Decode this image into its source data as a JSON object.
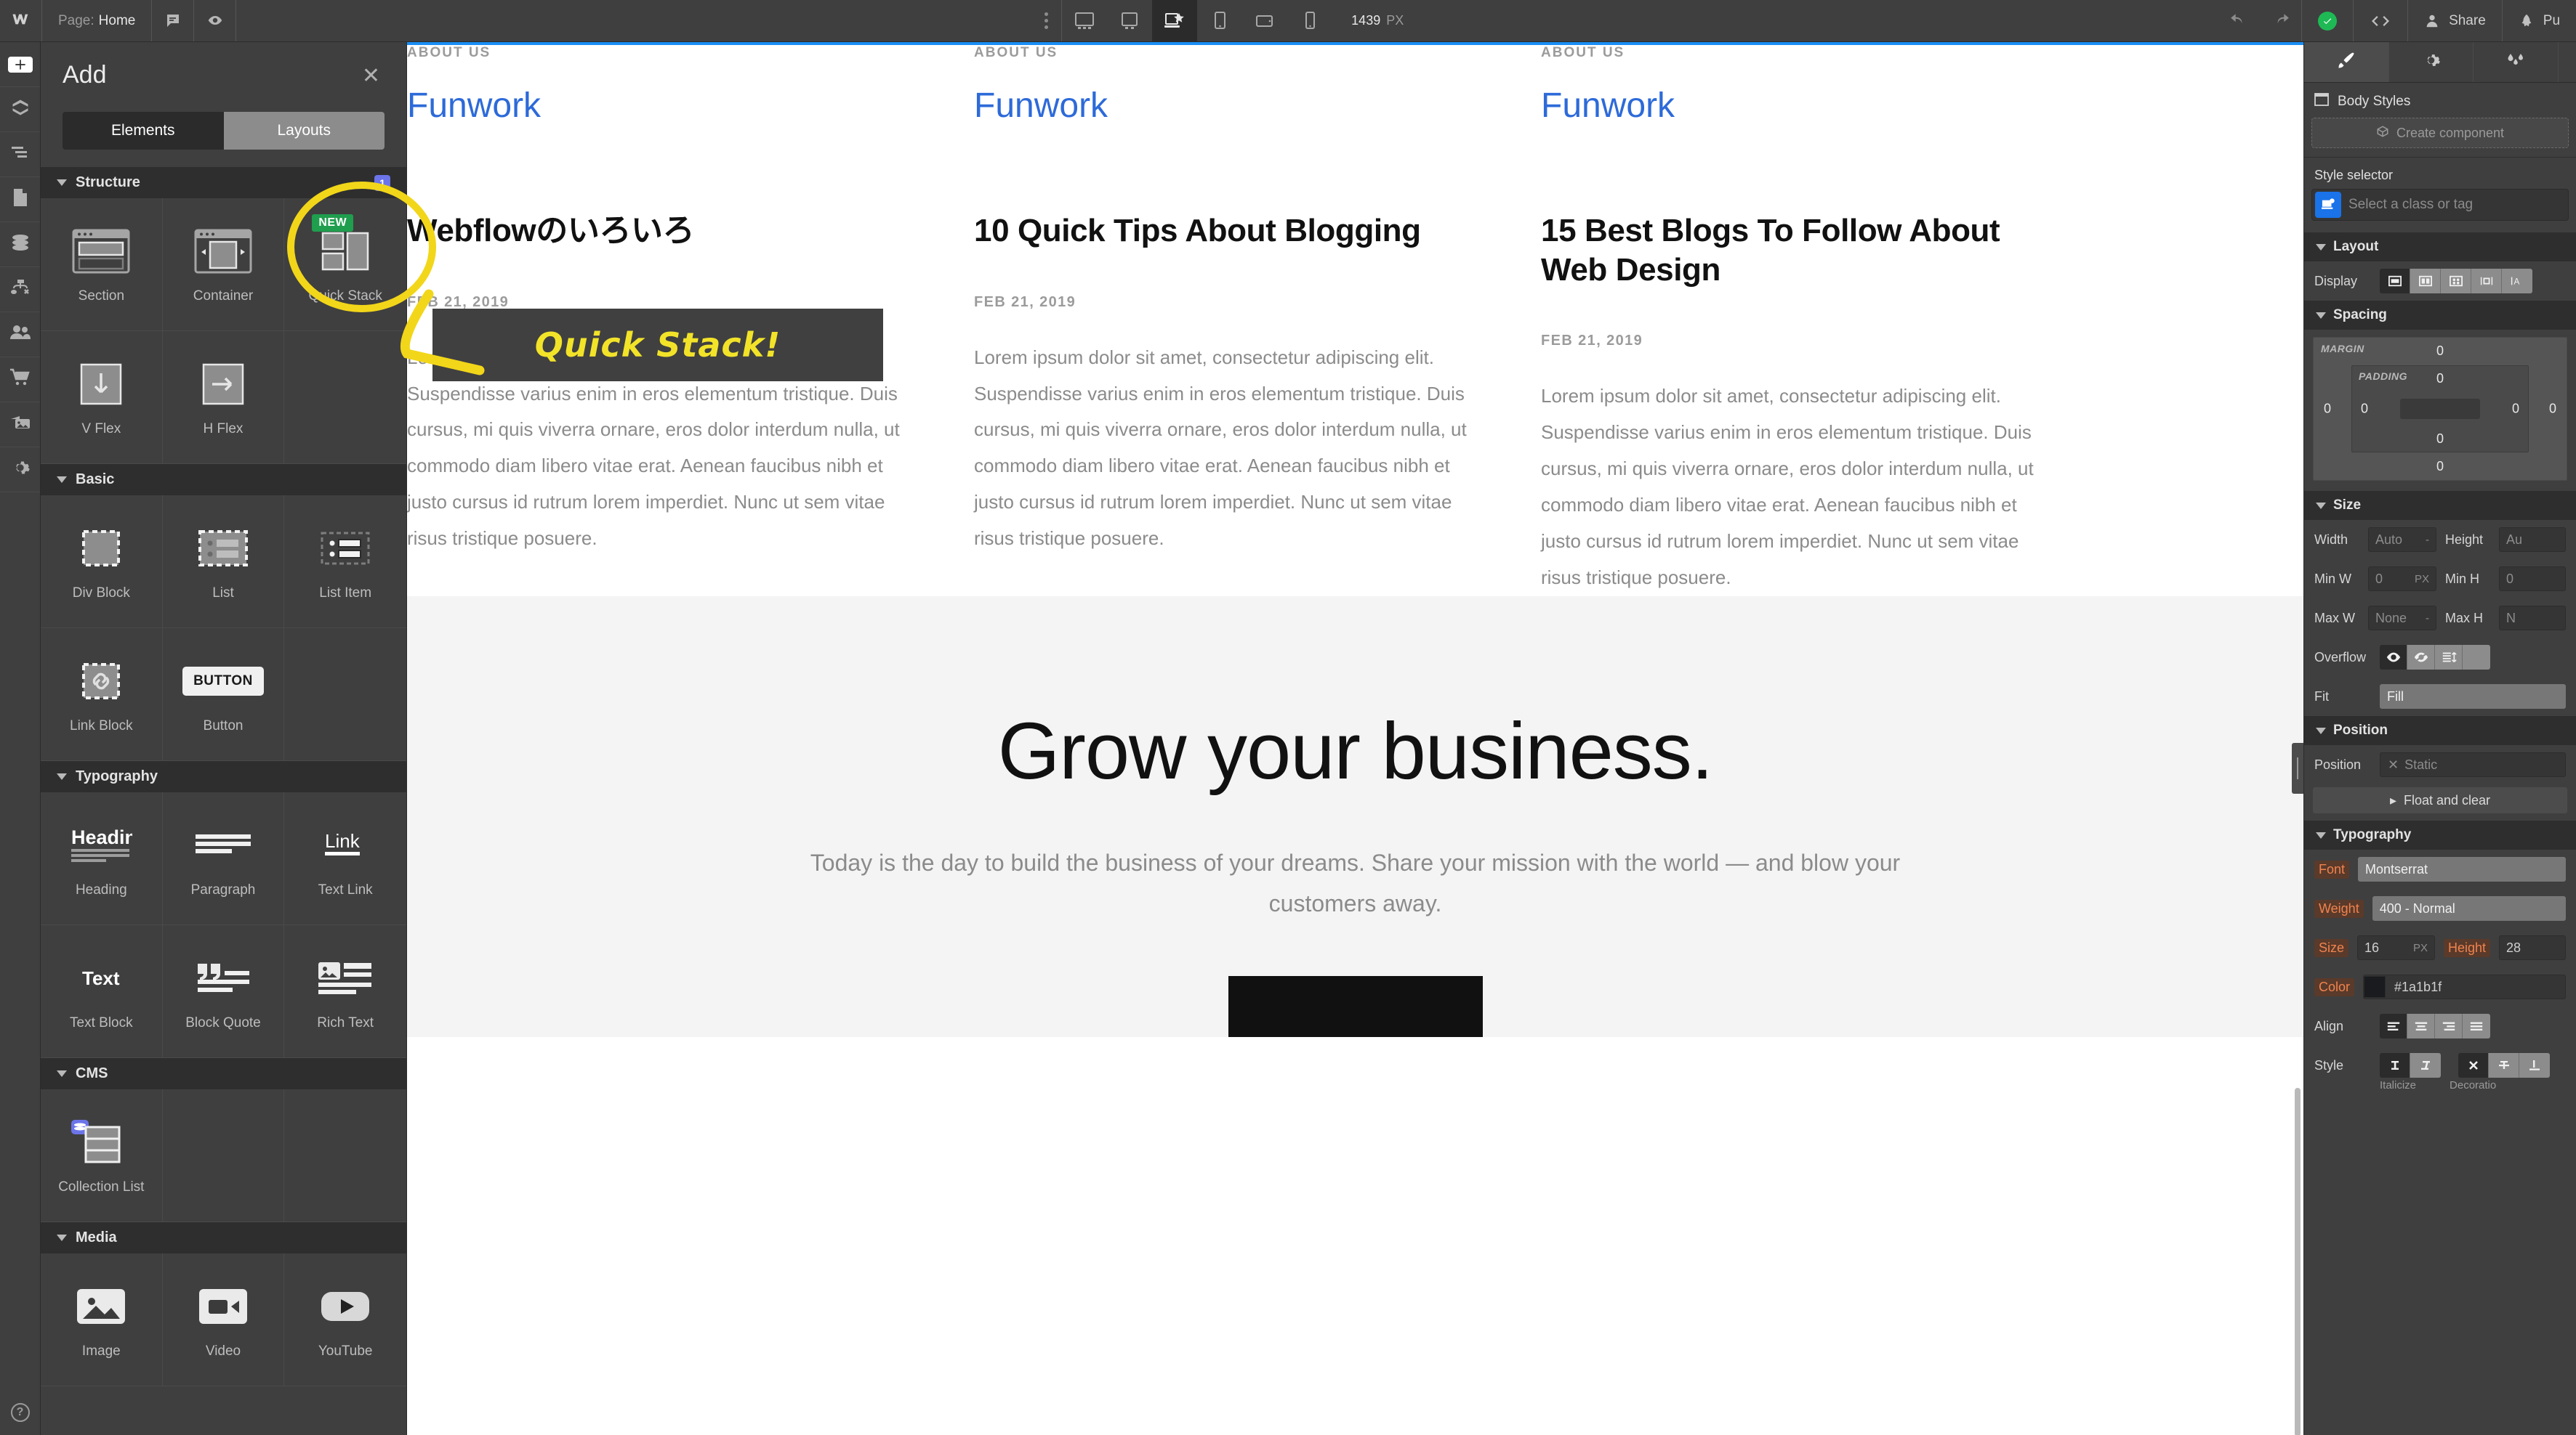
{
  "topbar": {
    "logo_icon": "webflow-logo-icon",
    "page_label": "Page:",
    "page_name": "Home",
    "comment_icon": "comment-icon",
    "preview_icon": "eye-icon",
    "breakpoints": [
      {
        "name": "desktop-xl",
        "icon": "monitor-large-icon",
        "active": false
      },
      {
        "name": "desktop-large",
        "icon": "monitor-icon",
        "active": false
      },
      {
        "name": "desktop-base",
        "icon": "laptop-star-icon",
        "active": true
      },
      {
        "name": "tablet",
        "icon": "tablet-icon",
        "active": false
      },
      {
        "name": "mobile-landscape",
        "icon": "mobile-landscape-icon",
        "active": false
      },
      {
        "name": "mobile-portrait",
        "icon": "mobile-portrait-icon",
        "active": false
      }
    ],
    "viewport_size": "1439",
    "viewport_unit": "PX",
    "undo_icon": "undo-icon",
    "redo_icon": "redo-icon",
    "saved_icon": "check-circle-icon",
    "code_icon": "code-brackets-icon",
    "share_label": "Share",
    "share_icon": "person-icon",
    "publish_label": "Pu",
    "publish_icon": "rocket-icon"
  },
  "rail": {
    "items": [
      {
        "name": "add-elements",
        "icon": "plus-icon",
        "active": true
      },
      {
        "name": "components",
        "icon": "cube-icon",
        "active": false
      },
      {
        "name": "navigator",
        "icon": "layers-list-icon",
        "active": false
      },
      {
        "name": "pages",
        "icon": "page-icon",
        "active": false
      },
      {
        "name": "cms",
        "icon": "database-icon",
        "active": false
      },
      {
        "name": "logic",
        "icon": "flow-node-icon",
        "active": false
      },
      {
        "name": "users",
        "icon": "users-icon",
        "active": false
      },
      {
        "name": "ecommerce",
        "icon": "cart-icon",
        "active": false
      },
      {
        "name": "assets",
        "icon": "photos-icon",
        "active": false
      },
      {
        "name": "settings",
        "icon": "gear-icon",
        "active": false
      }
    ],
    "help_label": "?"
  },
  "add_panel": {
    "title": "Add",
    "close_icon": "close-icon",
    "tabs": [
      {
        "label": "Elements",
        "active": true
      },
      {
        "label": "Layouts",
        "active": false
      }
    ],
    "sections": [
      {
        "title": "Structure",
        "badge": "1",
        "items": [
          {
            "label": "Section",
            "icon": "section-icon",
            "badge": ""
          },
          {
            "label": "Container",
            "icon": "container-icon",
            "badge": ""
          },
          {
            "label": "Quick Stack",
            "icon": "quick-stack-icon",
            "badge": "NEW"
          },
          {
            "label": "V Flex",
            "icon": "vertical-flex-icon",
            "badge": ""
          },
          {
            "label": "H Flex",
            "icon": "horizontal-flex-icon",
            "badge": ""
          },
          {
            "label": "",
            "icon": "",
            "badge": ""
          }
        ]
      },
      {
        "title": "Basic",
        "badge": "",
        "items": [
          {
            "label": "Div Block",
            "icon": "div-block-icon",
            "badge": ""
          },
          {
            "label": "List",
            "icon": "list-icon",
            "badge": ""
          },
          {
            "label": "List Item",
            "icon": "list-item-icon",
            "badge": ""
          },
          {
            "label": "Link Block",
            "icon": "link-block-icon",
            "badge": ""
          },
          {
            "label": "Button",
            "icon": "button-icon",
            "badge": ""
          },
          {
            "label": "",
            "icon": "",
            "badge": ""
          }
        ]
      },
      {
        "title": "Typography",
        "badge": "",
        "items": [
          {
            "label": "Heading",
            "icon": "heading-icon",
            "badge": ""
          },
          {
            "label": "Paragraph",
            "icon": "paragraph-icon",
            "badge": ""
          },
          {
            "label": "Text Link",
            "icon": "text-link-icon",
            "badge": ""
          },
          {
            "label": "Text Block",
            "icon": "text-block-icon",
            "badge": ""
          },
          {
            "label": "Block Quote",
            "icon": "block-quote-icon",
            "badge": ""
          },
          {
            "label": "Rich Text",
            "icon": "rich-text-icon",
            "badge": ""
          }
        ]
      },
      {
        "title": "CMS",
        "badge": "",
        "items": [
          {
            "label": "Collection List",
            "icon": "collection-list-icon",
            "badge": ""
          },
          {
            "label": "",
            "icon": "",
            "badge": ""
          },
          {
            "label": "",
            "icon": "",
            "badge": ""
          }
        ]
      },
      {
        "title": "Media",
        "badge": "",
        "items": [
          {
            "label": "Image",
            "icon": "image-icon",
            "badge": ""
          },
          {
            "label": "Video",
            "icon": "video-icon",
            "badge": ""
          },
          {
            "label": "YouTube",
            "icon": "youtube-icon",
            "badge": ""
          }
        ]
      }
    ]
  },
  "annotation": {
    "text": "Quick Stack!",
    "highlight_color": "#f2d619",
    "text_color": "#f2e329",
    "box_color": "#404040"
  },
  "canvas": {
    "selection_color": "#1a8ef5",
    "cards": [
      {
        "eyebrow": "ABOUT US",
        "brand": "Funwork",
        "title": "Webflowのいろいろ",
        "date": "FEB 21, 2019",
        "body": "Lorem ipsum dolor sit amet, consectetur adipiscing elit. Suspendisse varius enim in eros elementum tristique. Duis cursus, mi quis viverra ornare, eros dolor interdum nulla, ut commodo diam libero vitae erat. Aenean faucibus nibh et justo cursus id rutrum lorem imperdiet. Nunc ut sem vitae risus tristique posuere."
      },
      {
        "eyebrow": "ABOUT US",
        "brand": "Funwork",
        "title": "10 Quick Tips About Blogging",
        "date": "FEB 21, 2019",
        "body": "Lorem ipsum dolor sit amet, consectetur adipiscing elit. Suspendisse varius enim in eros elementum tristique. Duis cursus, mi quis viverra ornare, eros dolor interdum nulla, ut commodo diam libero vitae erat. Aenean faucibus nibh et justo cursus id rutrum lorem imperdiet. Nunc ut sem vitae risus tristique posuere."
      },
      {
        "eyebrow": "ABOUT US",
        "brand": "Funwork",
        "title": "15 Best Blogs To Follow About Web Design",
        "date": "FEB 21, 2019",
        "body": "Lorem ipsum dolor sit amet, consectetur adipiscing elit. Suspendisse varius enim in eros elementum tristique. Duis cursus, mi quis viverra ornare, eros dolor interdum nulla, ut commodo diam libero vitae erat. Aenean faucibus nibh et justo cursus id rutrum lorem imperdiet. Nunc ut sem vitae risus tristique posuere."
      }
    ],
    "hero": {
      "heading": "Grow your business.",
      "subheading": "Today is the day to build the business of your dreams. Share your mission with the world — and blow your customers away."
    }
  },
  "style_panel": {
    "tabs": [
      {
        "name": "style",
        "icon": "paintbrush-icon",
        "active": true
      },
      {
        "name": "settings",
        "icon": "gear-icon",
        "active": false
      },
      {
        "name": "interactions",
        "icon": "drops-icon",
        "active": false
      }
    ],
    "body_styles_label": "Body Styles",
    "body_styles_icon": "window-icon",
    "create_component_label": "Create component",
    "create_component_icon": "cube-icon",
    "style_selector_label": "Style selector",
    "style_selector_placeholder": "Select a class or tag",
    "style_selector_icon": "element-badge-icon",
    "layout": {
      "title": "Layout",
      "display_label": "Display",
      "display_options": [
        {
          "name": "block",
          "active": true
        },
        {
          "name": "flex",
          "active": false
        },
        {
          "name": "grid",
          "active": false
        },
        {
          "name": "inline-block",
          "active": false
        },
        {
          "name": "inline",
          "active": false
        }
      ]
    },
    "spacing": {
      "title": "Spacing",
      "margin_label": "MARGIN",
      "padding_label": "PADDING",
      "margin": {
        "top": "0",
        "right": "0",
        "bottom": "0",
        "left": "0"
      },
      "padding": {
        "top": "0",
        "right": "0",
        "bottom": "0",
        "left": "0"
      }
    },
    "size": {
      "title": "Size",
      "width_label": "Width",
      "width_value": "Auto",
      "width_unit": "-",
      "height_label": "Height",
      "height_value": "Au",
      "minw_label": "Min W",
      "minw_value": "0",
      "minw_unit": "PX",
      "minh_label": "Min H",
      "minh_value": "0",
      "maxw_label": "Max W",
      "maxw_value": "None",
      "maxw_unit": "-",
      "maxh_label": "Max H",
      "maxh_value": "N",
      "overflow_label": "Overflow",
      "overflow_options": [
        {
          "name": "visible",
          "icon": "eye-icon",
          "active": true
        },
        {
          "name": "hidden",
          "icon": "eye-off-icon",
          "active": false
        },
        {
          "name": "scroll",
          "icon": "scroll-icon",
          "active": false
        }
      ],
      "fit_label": "Fit",
      "fit_value": "Fill"
    },
    "position": {
      "title": "Position",
      "position_label": "Position",
      "position_value": "Static",
      "position_icon": "close-icon",
      "float_clear_label": "Float and clear",
      "float_clear_icon": "chevron-right-icon"
    },
    "typography": {
      "title": "Typography",
      "font_label": "Font",
      "font_value": "Montserrat",
      "weight_label": "Weight",
      "weight_value": "400 - Normal",
      "size_label": "Size",
      "size_value": "16",
      "size_unit": "PX",
      "height_label": "Height",
      "height_value": "28",
      "color_label": "Color",
      "color_value": "#1a1b1f",
      "align_label": "Align",
      "align_options": [
        {
          "name": "left",
          "active": true
        },
        {
          "name": "center",
          "active": false
        },
        {
          "name": "right",
          "active": false
        },
        {
          "name": "justify",
          "active": false
        }
      ],
      "style_label": "Style",
      "italicize_label": "Italicize",
      "decoration_label": "Decoratio",
      "style_options": [
        {
          "name": "upright",
          "active": true
        },
        {
          "name": "italic",
          "active": false
        }
      ],
      "decoration_options": [
        {
          "name": "none",
          "active": true
        },
        {
          "name": "strikethrough",
          "active": false
        },
        {
          "name": "underline",
          "active": false
        }
      ]
    }
  }
}
